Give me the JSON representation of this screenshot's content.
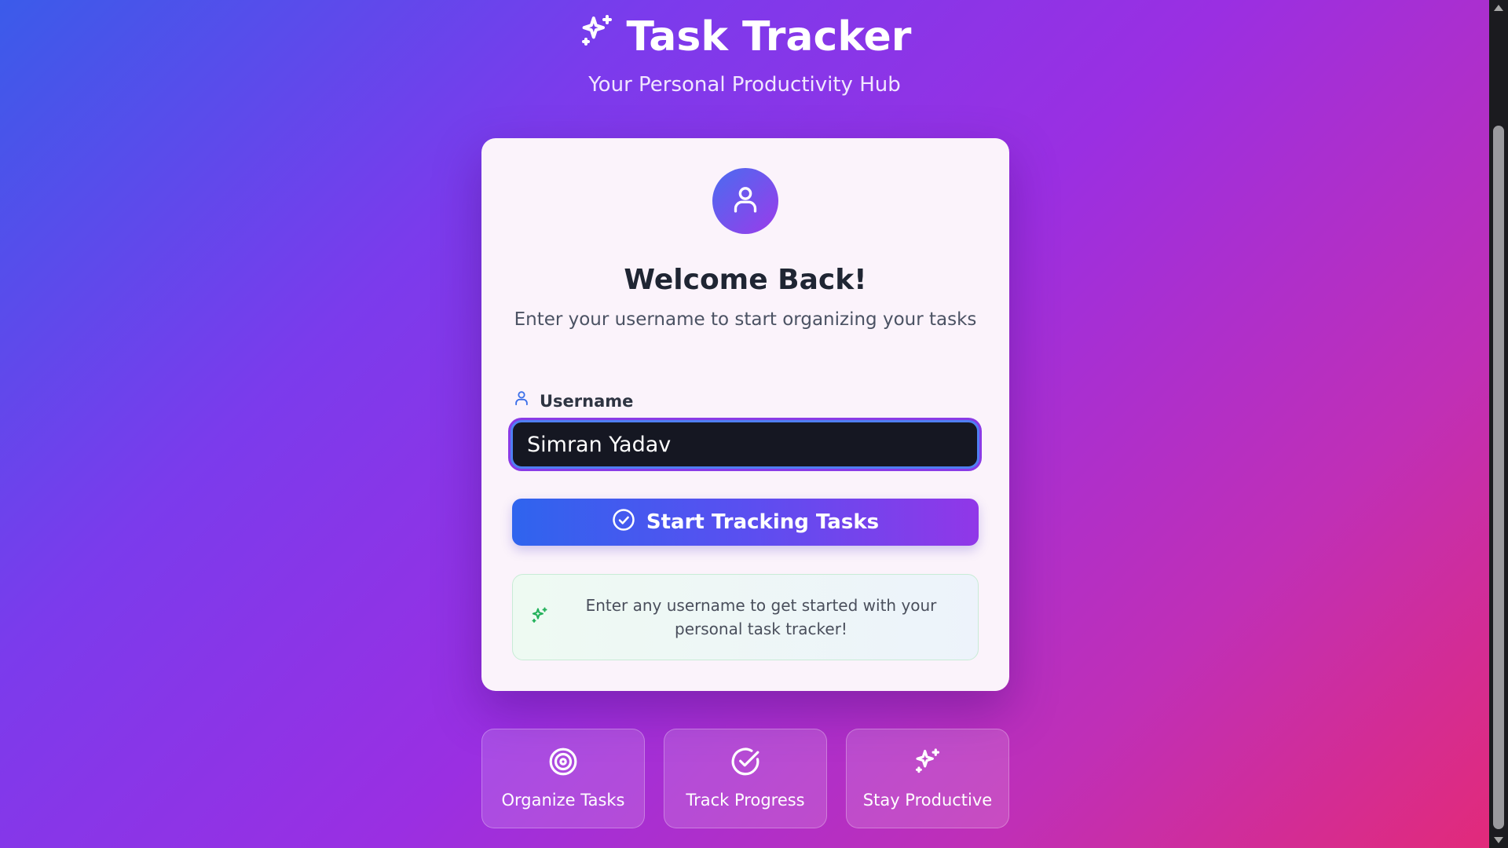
{
  "header": {
    "title": "Task Tracker",
    "subtitle": "Your Personal Productivity Hub",
    "title_icon": "sparkles-icon"
  },
  "login_card": {
    "avatar_icon": "user-icon",
    "heading": "Welcome Back!",
    "description": "Enter your username to start organizing your tasks",
    "username_field": {
      "label": "Username",
      "label_icon": "user-icon",
      "value": "Simran Yadav"
    },
    "submit_button": {
      "label": "Start Tracking Tasks",
      "icon": "check-circle-icon"
    },
    "hint": {
      "icon": "sparkles-icon",
      "text": "Enter any username to get started with your personal task tracker!"
    }
  },
  "features": [
    {
      "label": "Organize Tasks",
      "icon": "target-icon"
    },
    {
      "label": "Track Progress",
      "icon": "check-circle-icon"
    },
    {
      "label": "Stay Productive",
      "icon": "sparkles-icon"
    }
  ],
  "colors": {
    "gradient_start": "#3b5bea",
    "gradient_mid": "#9a2fe2",
    "gradient_end": "#e32a78",
    "card_background": "#fbf3fb",
    "input_background": "#151722",
    "input_focus_border": "#4f7ff2",
    "button_gradient_start": "#2f64ee",
    "button_gradient_end": "#9137e8",
    "hint_icon": "#22b15a",
    "label_icon": "#3b6fe8"
  }
}
